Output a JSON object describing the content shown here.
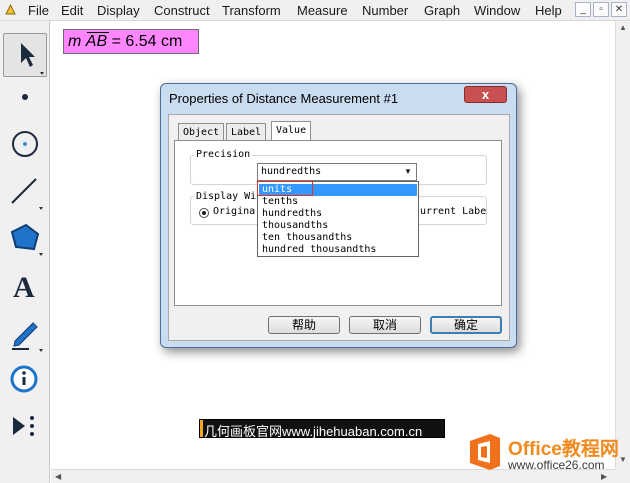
{
  "menu": {
    "items": [
      "File",
      "Edit",
      "Display",
      "Construct",
      "Transform",
      "Measure",
      "Number",
      "Graph",
      "Window",
      "Help"
    ],
    "window_buttons": [
      "_",
      "▫",
      "✕"
    ]
  },
  "toolbox": {
    "tools": [
      "arrow-select-tool",
      "point-tool",
      "compass-tool",
      "straightedge-tool",
      "polygon-tool",
      "text-tool",
      "marker-tool",
      "information-tool",
      "custom-tool"
    ],
    "text_tool_glyph": "A"
  },
  "canvas": {
    "measurement": {
      "prefix": "m",
      "segment": "AB",
      "value_text": "= 6.54 cm"
    }
  },
  "dialog": {
    "title": "Properties of Distance Measurement #1",
    "close_glyph": "x",
    "tabs": [
      "Object",
      "Label",
      "Value"
    ],
    "active_tab": "Value",
    "precision_group_label": "Precision",
    "precision_value": "hundredths",
    "display_group_label": "Display Wi",
    "radio_original_label": "Origina",
    "radio_current_label": "urrent Labe",
    "buttons": {
      "help": "帮助",
      "cancel": "取消",
      "ok": "确定"
    },
    "dropdown_options": [
      "units",
      "tenths",
      "hundredths",
      "thousandths",
      "ten thousandths",
      "hundred thousandths"
    ],
    "highlighted_option": "units"
  },
  "watermarks": {
    "site_text": "几何画板官网www.jihehuaban.com.cn",
    "office_name": "Office教程网",
    "office_url": "www.office26.com"
  },
  "colors": {
    "measurement_bg": "#ff86ff",
    "dialog_frame": "#c9dcf0",
    "selection": "#3399ff",
    "close_button": "#c75050",
    "office_orange": "#f08a1f"
  }
}
